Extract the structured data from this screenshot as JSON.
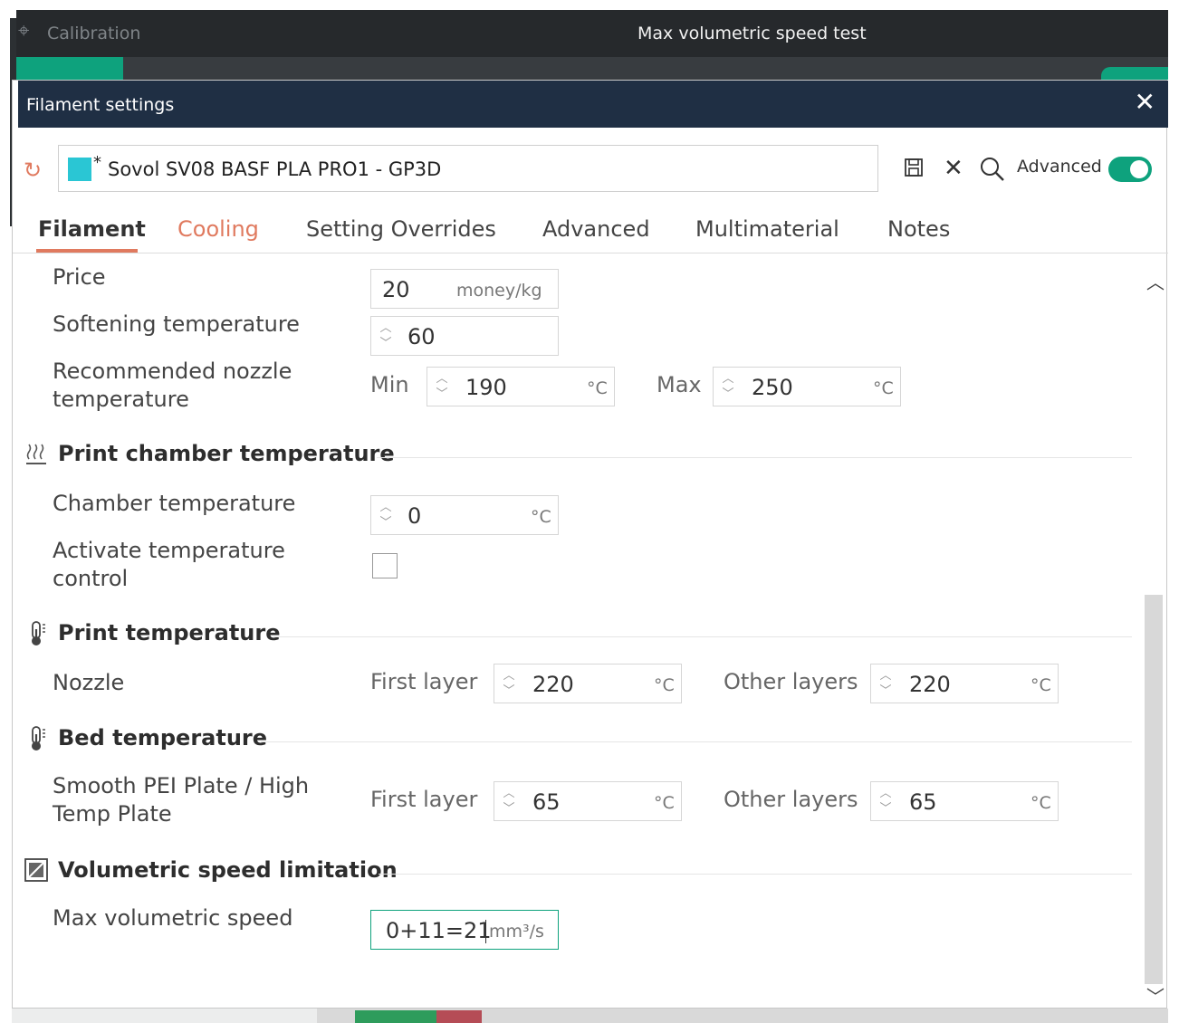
{
  "background_app": {
    "app_label": "Calibration",
    "window_title": "Max volumetric speed test"
  },
  "dialog": {
    "title": "Filament settings",
    "close_glyph": "✕"
  },
  "preset": {
    "name": "Sovol SV08 BASF PLA PRO1 - GP3D",
    "modified_marker": "*",
    "swatch_color": "#2ac6d4",
    "advanced_label": "Advanced",
    "advanced_enabled": true
  },
  "tabs": [
    {
      "label": "Filament",
      "active": true
    },
    {
      "label": "Cooling",
      "active": false
    },
    {
      "label": "Setting Overrides",
      "active": false
    },
    {
      "label": "Advanced",
      "active": false
    },
    {
      "label": "Multimaterial",
      "active": false
    },
    {
      "label": "Notes",
      "active": false
    }
  ],
  "fields": {
    "price": {
      "label": "Price",
      "value": "20",
      "unit": "money/kg"
    },
    "softening": {
      "label": "Softening temperature",
      "value": "60"
    },
    "nozzle_range": {
      "label_line1": "Recommended nozzle",
      "label_line2": "temperature",
      "min_label": "Min",
      "min_value": "190",
      "max_label": "Max",
      "max_value": "250",
      "unit": "°C"
    }
  },
  "sections": {
    "chamber": {
      "title": "Print chamber temperature",
      "chamber_temp": {
        "label": "Chamber temperature",
        "value": "0",
        "unit": "°C"
      },
      "activate": {
        "label_line1": "Activate temperature",
        "label_line2": "control",
        "checked": false
      }
    },
    "print_temp": {
      "title": "Print temperature",
      "nozzle": {
        "label": "Nozzle",
        "first_label": "First layer",
        "first_value": "220",
        "other_label": "Other layers",
        "other_value": "220",
        "unit": "°C"
      }
    },
    "bed_temp": {
      "title": "Bed temperature",
      "plate": {
        "label_line1": "Smooth PEI Plate / High",
        "label_line2": "Temp Plate",
        "first_label": "First layer",
        "first_value": "65",
        "other_label": "Other layers",
        "other_value": "65",
        "unit": "°C"
      }
    },
    "volumetric": {
      "title": "Volumetric speed limitation",
      "max_speed": {
        "label": "Max volumetric speed",
        "value": "0+11=21",
        "unit": "mm³/s"
      }
    }
  },
  "colors": {
    "accent_green": "#0ea27d",
    "accent_orange": "#e07a5f",
    "titlebar_dark": "#1f2f44"
  }
}
